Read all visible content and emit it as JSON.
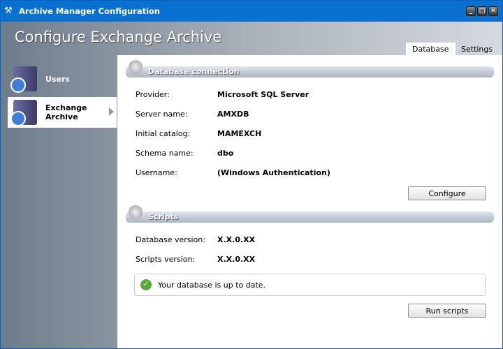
{
  "window": {
    "title": "Archive Manager Configuration"
  },
  "header": {
    "title": "Configure Exchange Archive"
  },
  "tabs": [
    {
      "label": "Database"
    },
    {
      "label": "Settings"
    }
  ],
  "sidebar": {
    "items": [
      {
        "label": "Users"
      },
      {
        "label": "Exchange Archive"
      }
    ]
  },
  "database": {
    "title": "Database connection",
    "fields": [
      {
        "label": "Provider:",
        "value": "Microsoft SQL Server"
      },
      {
        "label": "Server name:",
        "value": "AMXDB"
      },
      {
        "label": "Initial catalog:",
        "value": "MAMEXCH"
      },
      {
        "label": "Schema name:",
        "value": "dbo"
      },
      {
        "label": "Username:",
        "value": "(Windows Authentication)"
      }
    ],
    "configure_label": "Configure"
  },
  "scripts": {
    "title": "Scripts",
    "fields": [
      {
        "label": "Database version:",
        "value": "X.X.0.XX"
      },
      {
        "label": "Scripts version:",
        "value": "X.X.0.XX"
      }
    ],
    "status": "Your database is up to date.",
    "run_label": "Run scripts"
  }
}
